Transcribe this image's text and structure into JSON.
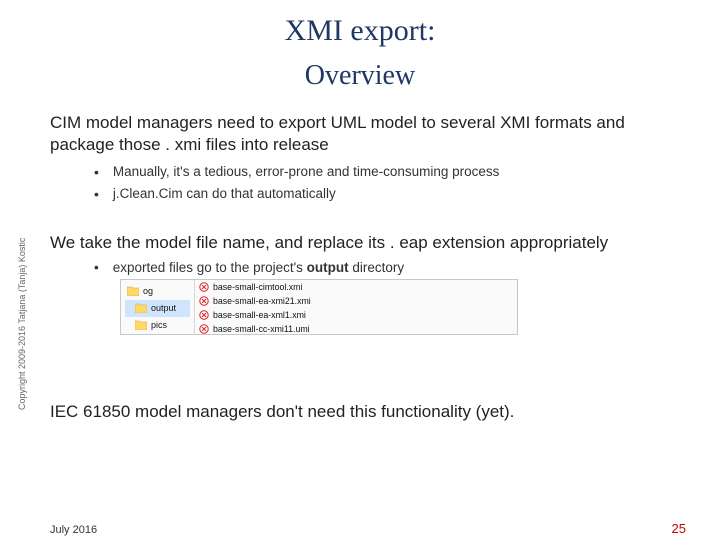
{
  "title": "XMI export:",
  "subtitle": "Overview",
  "para1": "CIM model managers need to export UML model to several XMI formats and package those . xmi files into release",
  "b1": "Manually, it's a tedious, error-prone and time-consuming process",
  "b2": "j.Clean.Cim can do that automatically",
  "para2": "We take the model file name, and replace its . eap extension appropriately",
  "exp_pre": "exported files go to the project's ",
  "exp_bold": "output",
  "exp_post": " directory",
  "folders": {
    "root": "og",
    "output": "output",
    "pics": "pics"
  },
  "files": [
    "base-small-cimtool.xmi",
    "base-small-ea-xmi21.xmi",
    "base-small-ea-xml1.xmi",
    "base-small-cc-xmi11.umi"
  ],
  "para3": "IEC 61850 model managers don't need this functionality (yet).",
  "copyright": "Copyright 2009-2016 Tatjana (Tanja) Kostic",
  "date": "July 2016",
  "page": "25"
}
